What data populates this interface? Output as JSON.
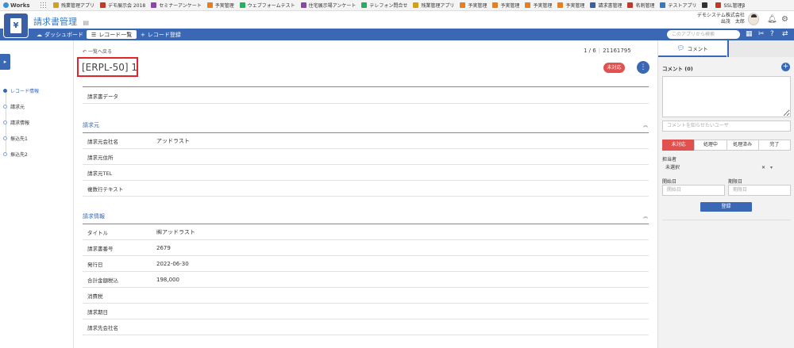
{
  "topbar": {
    "logo": "Works",
    "apps": [
      {
        "label": "残業管理アプリ",
        "color": "#d4a017"
      },
      {
        "label": "デモ展示会 2018",
        "color": "#c0392b"
      },
      {
        "label": "セミナーアンケート",
        "color": "#8e44ad"
      },
      {
        "label": "予実管理",
        "color": "#e67e22"
      },
      {
        "label": "ウェブフォームテスト",
        "color": "#27ae60"
      },
      {
        "label": "住宅展示場アンケート",
        "color": "#8e44ad"
      },
      {
        "label": "テレフォン問合せ",
        "color": "#27ae60"
      },
      {
        "label": "残業管理アプリ",
        "color": "#d4a017"
      },
      {
        "label": "予実管理",
        "color": "#e67e22"
      },
      {
        "label": "予実管理",
        "color": "#e67e22"
      },
      {
        "label": "予実管理",
        "color": "#e67e22"
      },
      {
        "label": "予実管理",
        "color": "#e67e22"
      },
      {
        "label": "請求書管理",
        "color": "#3b5fa6"
      },
      {
        "label": "名刺管理",
        "color": "#c0392b"
      },
      {
        "label": "テストアプリ",
        "color": "#2f7cc5"
      },
      {
        "label": "",
        "color": "#333333"
      },
      {
        "label": "SSL管理β",
        "color": "#c0392b"
      }
    ]
  },
  "header": {
    "app_icon_glyph": "¥",
    "title": "請求書管理",
    "memo_icon": "memo-icon",
    "company": "デモシステム株式会社",
    "user": "出茂　太郎",
    "bell_icon": "bell-icon",
    "gear_icon": "gear-icon"
  },
  "nav": {
    "tabs": [
      {
        "label": "ダッシュボード",
        "icon": "☁"
      },
      {
        "label": "レコード一覧",
        "icon": "☰"
      },
      {
        "label": "レコード登録",
        "icon": "+"
      }
    ],
    "search_placeholder": "このアプリから検索"
  },
  "toc": {
    "items": [
      "レコード情報",
      "請求元",
      "請求情報",
      "振込先1",
      "振込先2"
    ]
  },
  "record": {
    "back": "一覧へ戻る",
    "pager_pos": "1 / 6",
    "pager_sep": "|",
    "pager_id": "21161795",
    "title": "[ERPL-50] 1",
    "status": "未対応",
    "more_glyph": "⋮",
    "top_rows": [
      {
        "label": "請求書データ",
        "value": ""
      }
    ],
    "sections": [
      {
        "title": "請求元",
        "rows": [
          {
            "label": "請求元会社名",
            "value": "アッドラスト"
          },
          {
            "label": "請求元住所",
            "value": ""
          },
          {
            "label": "請求元TEL",
            "value": ""
          },
          {
            "label": "複数行テキスト",
            "value": ""
          }
        ]
      },
      {
        "title": "請求情報",
        "rows": [
          {
            "label": "タイトル",
            "value": "㈱アッドラスト"
          },
          {
            "label": "請求書番号",
            "value": "2679"
          },
          {
            "label": "発行日",
            "value": "2022-06-30"
          },
          {
            "label": "合計金額税込",
            "value": "198,000"
          },
          {
            "label": "消費税",
            "value": ""
          },
          {
            "label": "請求期日",
            "value": ""
          },
          {
            "label": "請求先会社名",
            "value": ""
          }
        ]
      }
    ]
  },
  "comments": {
    "tab": "コメント",
    "heading": "コメント (0)",
    "notify_placeholder": "コメントを知らせたいユーザ",
    "status_buttons": [
      "未対応",
      "処理中",
      "処理済み",
      "完了"
    ],
    "assignee_label": "担当者",
    "assignee_value": "未選択",
    "start_label": "開始日",
    "end_label": "期限日",
    "start_placeholder": "開始日",
    "end_placeholder": "期限日",
    "submit": "登録"
  }
}
